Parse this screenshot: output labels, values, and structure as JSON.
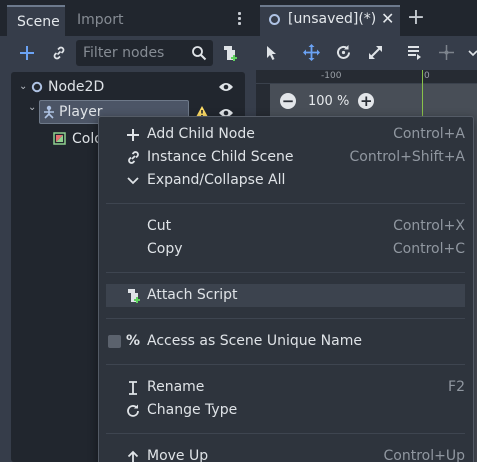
{
  "dock": {
    "tabs": [
      "Scene",
      "Import"
    ],
    "filter_placeholder": "Filter nodes",
    "tree": [
      {
        "label": "Node2D"
      },
      {
        "label": "Player"
      },
      {
        "label": "Colo"
      }
    ]
  },
  "editor": {
    "scene_tab": "[unsaved](*)",
    "ruler": [
      "-100",
      "0"
    ],
    "zoom": "100 %"
  },
  "context_menu": {
    "items": [
      {
        "label": "Add Child Node",
        "shortcut": "Control+A",
        "icon": "plus-icon"
      },
      {
        "label": "Instance Child Scene",
        "shortcut": "Control+Shift+A",
        "icon": "link-icon"
      },
      {
        "label": "Expand/Collapse All",
        "shortcut": "",
        "icon": "chevron-down-icon"
      },
      {
        "label": "Cut",
        "shortcut": "Control+X",
        "icon": ""
      },
      {
        "label": "Copy",
        "shortcut": "Control+C",
        "icon": ""
      },
      {
        "label": "Attach Script",
        "shortcut": "",
        "icon": "script-add-icon"
      },
      {
        "label": "Access as Scene Unique Name",
        "shortcut": "",
        "icon": "percent-icon"
      },
      {
        "label": "Rename",
        "shortcut": "F2",
        "icon": "text-cursor-icon"
      },
      {
        "label": "Change Type",
        "shortcut": "",
        "icon": "rotate-icon"
      },
      {
        "label": "Move Up",
        "shortcut": "Control+Up",
        "icon": "arrow-up-icon"
      }
    ]
  },
  "colors": {
    "accent": "#6ba3f5",
    "warning": "#ffdd66",
    "y_axis": "#89c24a"
  }
}
